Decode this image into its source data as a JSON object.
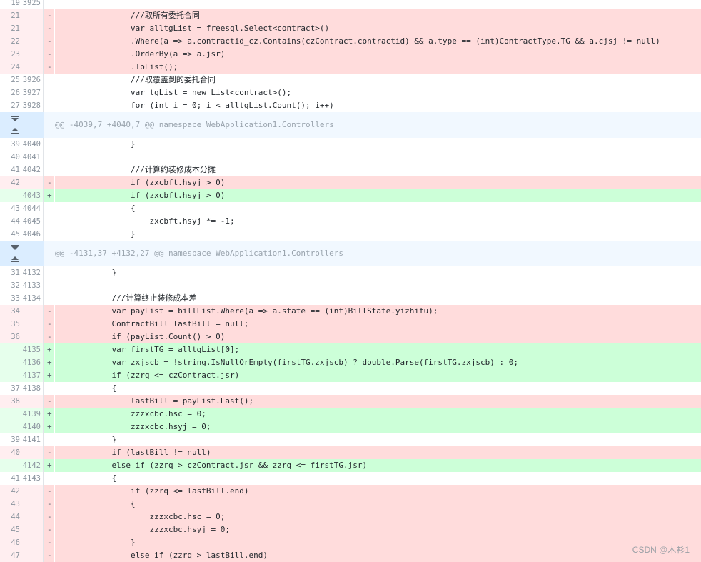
{
  "watermark": "CSDN @木衫1",
  "rows": [
    {
      "type": "ctx",
      "old": "19",
      "new": "3925",
      "text": ""
    },
    {
      "type": "del",
      "old": "21",
      "new": "",
      "text": "                ///取所有委托合同"
    },
    {
      "type": "del",
      "old": "21",
      "new": "",
      "text": "                var alltgList = freesql.Select<contract>()"
    },
    {
      "type": "del",
      "old": "22",
      "new": "",
      "text": "                .Where(a => a.contractid_cz.Contains(czContract.contractid) && a.type == (int)ContractType.TG && a.cjsj != null)"
    },
    {
      "type": "del",
      "old": "23",
      "new": "",
      "text": "                .OrderBy(a => a.jsr)"
    },
    {
      "type": "del",
      "old": "24",
      "new": "",
      "text": "                .ToList();"
    },
    {
      "type": "ctx",
      "old": "25",
      "new": "3926",
      "text": "                ///取覆盖到的委托合同"
    },
    {
      "type": "ctx",
      "old": "26",
      "new": "3927",
      "text": "                var tgList = new List<contract>();"
    },
    {
      "type": "ctx",
      "old": "27",
      "new": "3928",
      "text": "                for (int i = 0; i < alltgList.Count(); i++)"
    },
    {
      "type": "hunk",
      "text": "@@ -4039,7 +4040,7 @@ namespace WebApplication1.Controllers"
    },
    {
      "type": "ctx",
      "old": "39",
      "new": "4040",
      "text": "                }"
    },
    {
      "type": "ctx",
      "old": "40",
      "new": "4041",
      "text": ""
    },
    {
      "type": "ctx",
      "old": "41",
      "new": "4042",
      "text": "                ///计算约装修成本分摊"
    },
    {
      "type": "del",
      "old": "42",
      "new": "",
      "text": "                if (zxcbft.hsyj > 0) "
    },
    {
      "type": "add",
      "old": "",
      "new": "4043",
      "text": "                if (zxcbft.hsyj > 0)"
    },
    {
      "type": "ctx",
      "old": "43",
      "new": "4044",
      "text": "                {"
    },
    {
      "type": "ctx",
      "old": "44",
      "new": "4045",
      "text": "                    zxcbft.hsyj *= -1;"
    },
    {
      "type": "ctx",
      "old": "45",
      "new": "4046",
      "text": "                }"
    },
    {
      "type": "hunk",
      "text": "@@ -4131,37 +4132,27 @@ namespace WebApplication1.Controllers"
    },
    {
      "type": "ctx",
      "old": "31",
      "new": "4132",
      "text": "            }"
    },
    {
      "type": "ctx",
      "old": "32",
      "new": "4133",
      "text": ""
    },
    {
      "type": "ctx",
      "old": "33",
      "new": "4134",
      "text": "            ///计算终止装修成本差"
    },
    {
      "type": "del",
      "old": "34",
      "new": "",
      "text": "            var payList = billList.Where(a => a.state == (int)BillState.yizhifu);"
    },
    {
      "type": "del",
      "old": "35",
      "new": "",
      "text": "            ContractBill lastBill = null;"
    },
    {
      "type": "del",
      "old": "36",
      "new": "",
      "text": "            if (payList.Count() > 0) "
    },
    {
      "type": "add",
      "old": "",
      "new": "4135",
      "text": "            var firstTG = alltgList[0];"
    },
    {
      "type": "add",
      "old": "",
      "new": "4136",
      "text": "            var zxjscb = !string.IsNullOrEmpty(firstTG.zxjscb) ? double.Parse(firstTG.zxjscb) : 0;"
    },
    {
      "type": "add",
      "old": "",
      "new": "4137",
      "text": "            if (zzrq <= czContract.jsr)"
    },
    {
      "type": "ctx",
      "old": "37",
      "new": "4138",
      "text": "            {"
    },
    {
      "type": "del",
      "old": "38",
      "new": "",
      "text": "                lastBill = payList.Last();"
    },
    {
      "type": "add",
      "old": "",
      "new": "4139",
      "text": "                zzzxcbc.hsc = 0;"
    },
    {
      "type": "add",
      "old": "",
      "new": "4140",
      "text": "                zzzxcbc.hsyj = 0;"
    },
    {
      "type": "ctx",
      "old": "39",
      "new": "4141",
      "text": "            }"
    },
    {
      "type": "del",
      "old": "40",
      "new": "",
      "text": "            if (lastBill != null)"
    },
    {
      "type": "add",
      "old": "",
      "new": "4142",
      "text": "            else if (zzrq > czContract.jsr && zzrq <= firstTG.jsr)"
    },
    {
      "type": "ctx",
      "old": "41",
      "new": "4143",
      "text": "            {"
    },
    {
      "type": "del",
      "old": "42",
      "new": "",
      "text": "                if (zzrq <= lastBill.end)"
    },
    {
      "type": "del",
      "old": "43",
      "new": "",
      "text": "                {"
    },
    {
      "type": "del",
      "old": "44",
      "new": "",
      "text": "                    zzzxcbc.hsc = 0;"
    },
    {
      "type": "del",
      "old": "45",
      "new": "",
      "text": "                    zzzxcbc.hsyj = 0;"
    },
    {
      "type": "del",
      "old": "46",
      "new": "",
      "text": "                }"
    },
    {
      "type": "del",
      "old": "47",
      "new": "",
      "text": "                else if (zzrq > lastBill.end)"
    }
  ]
}
